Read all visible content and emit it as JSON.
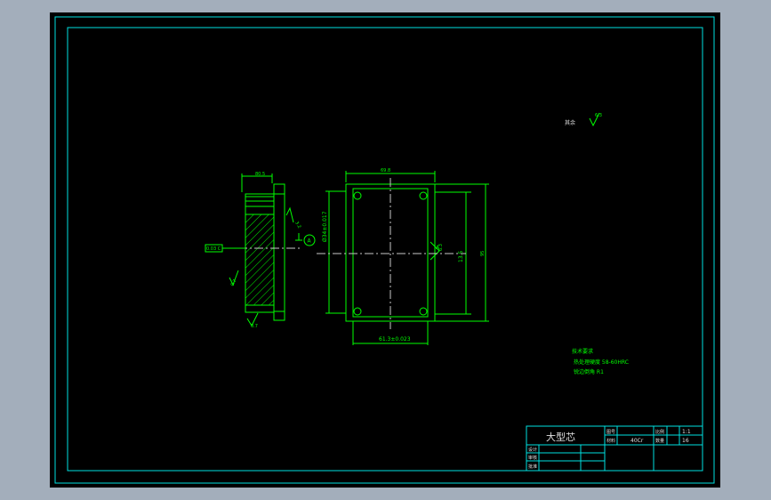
{
  "colors": {
    "viewport_bg": "#a3aebb",
    "paper": "#000000",
    "frame": "#00e0e0",
    "part": "#00ff00",
    "dim": "#00ff00",
    "center": "#c8c8c8",
    "title_text": "#e0e0e0"
  },
  "drawing": {
    "roughness_note": "其余",
    "roughness_value": "6.3",
    "side_view": {
      "top_dim": "80.5",
      "left_tolerance": "0.03 C",
      "datum_label": "A",
      "rough_left": "0.7",
      "rough_right": "3.2",
      "rough_bottom": "0.7"
    },
    "front_view": {
      "top_dim": "69.8",
      "bottom_dim": "61.3±0.023",
      "left_dim": "Ø34±0.017",
      "right_dim_inner": "13.5",
      "right_dim_outer": "95",
      "hole_label": "A",
      "rough_small": "6.3"
    },
    "tech_requirements": [
      "技术要求",
      "热处理硬度 58-60HRC",
      "锐边倒角 R1"
    ]
  },
  "title_block": {
    "part_name": "大型芯",
    "material_label": "材料",
    "material": "40Cr",
    "code_label": "图号",
    "scale_label": "比例",
    "scale": "1:1",
    "count_label": "数量",
    "count": "16",
    "design_label": "设计",
    "check_label": "审核",
    "approve_label": "批准"
  }
}
